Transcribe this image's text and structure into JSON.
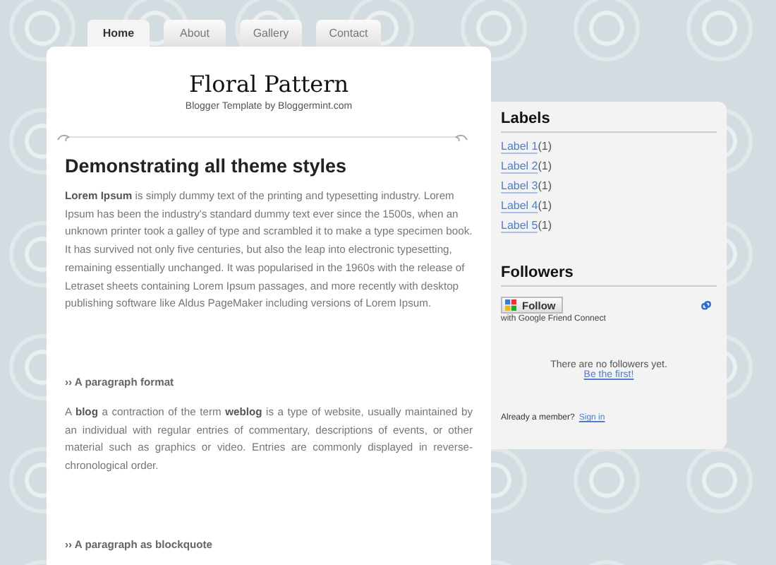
{
  "tabs": [
    {
      "label": "Home",
      "selected": true
    },
    {
      "label": "About",
      "selected": false
    },
    {
      "label": "Gallery",
      "selected": false
    },
    {
      "label": "Contact",
      "selected": false
    }
  ],
  "header": {
    "title": "Floral Pattern",
    "subtitle": "Blogger Template by Bloggermint.com"
  },
  "post": {
    "title": "Demonstrating all theme styles",
    "sections": [
      {
        "kind": "paragraph",
        "text": "**Lorem Ipsum** is simply dummy text of the printing and typesetting industry. Lorem Ipsum has been the industry's standard dummy text ever since the 1500s, when an unknown printer took a galley of type and scrambled it to make a type specimen book. It has survived not only five centuries, but also the leap into electronic typesetting, remaining essentially unchanged. It was popularised in the 1960s with the release of Letraset sheets containing Lorem Ipsum passages, and more recently with desktop publishing software like Aldus PageMaker including versions of Lorem Ipsum."
      },
      {
        "kind": "subheading",
        "text": "›› A paragraph format"
      },
      {
        "kind": "justified",
        "text": "A **blog** a contraction of the term **weblog** is a type of website, usually maintained by an individual with regular entries of commentary, descriptions of events, or other material such as graphics or video. Entries are commonly displayed in reverse-chronological order."
      },
      {
        "kind": "subheading",
        "text": "›› A paragraph as blockquote"
      }
    ]
  },
  "sidebar": {
    "labels": {
      "title": "Labels",
      "items": [
        {
          "label": "Label 1",
          "count": "(1)"
        },
        {
          "label": "Label 2",
          "count": "(1)"
        },
        {
          "label": "Label 3",
          "count": "(1)"
        },
        {
          "label": "Label 4",
          "count": "(1)"
        },
        {
          "label": "Label 5",
          "count": "(1)"
        }
      ]
    },
    "followers": {
      "title": "Followers",
      "button": "Follow",
      "caption": "with Google Friend Connect",
      "empty": "There are no followers yet.",
      "first_link": "Be the first!",
      "member_prompt": "Already a member?",
      "sign_in": "Sign in"
    }
  }
}
